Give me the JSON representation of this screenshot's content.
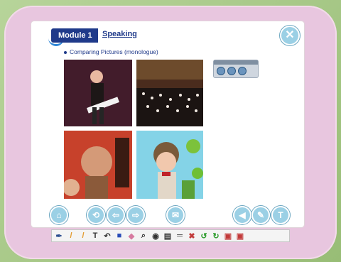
{
  "header": {
    "module_label": "Module 1",
    "section_label": "Speaking"
  },
  "subtitle": "Comparing Pictures (monologue)",
  "photos": [
    "guitarist-woman",
    "orchestra",
    "warrior-man",
    "clown-man"
  ],
  "icons": {
    "close": "close-icon",
    "home": "home-icon",
    "refresh": "refresh-icon",
    "back": "back-icon",
    "forward": "forward-icon",
    "mail": "mail-icon",
    "prev": "prev-icon",
    "edit": "edit-icon",
    "text": "text-icon"
  },
  "toolbar": {
    "items": [
      "pen-icon",
      "pencil-icon",
      "marker-icon",
      "text-tool",
      "curve-icon",
      "color-fill-icon",
      "eraser-icon",
      "zoom-icon",
      "view-icon",
      "document-icon",
      "line-icon",
      "delete-icon",
      "undo-icon",
      "redo-icon",
      "save-icon",
      "print-icon"
    ]
  }
}
